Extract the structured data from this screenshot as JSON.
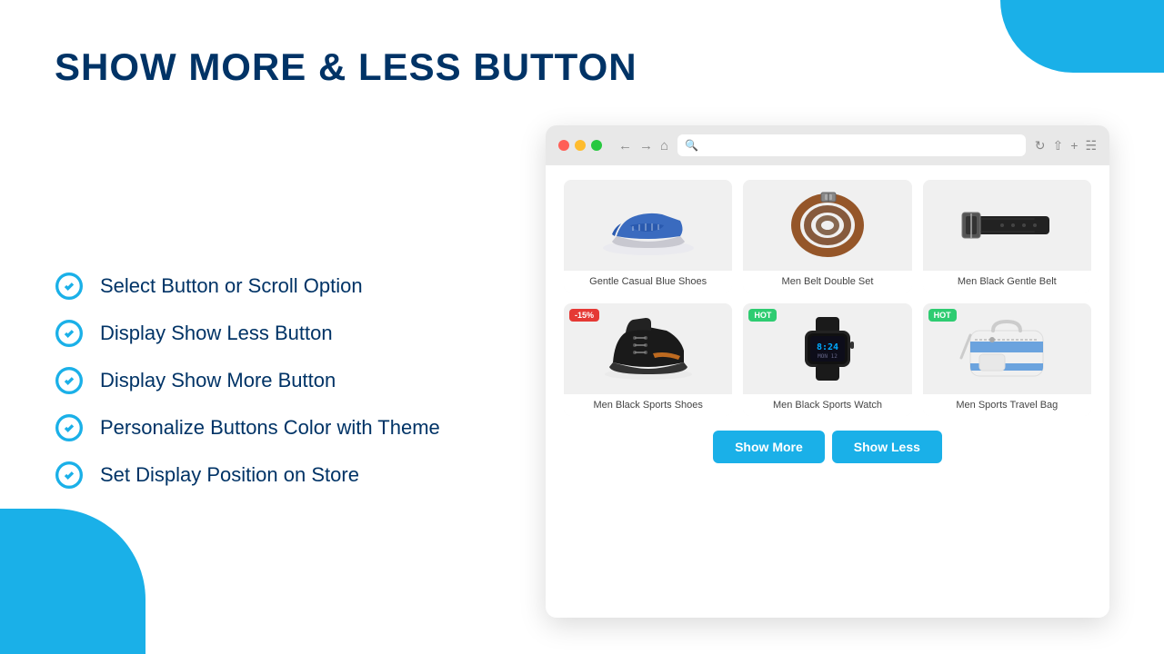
{
  "page": {
    "title": "SHOW MORE & LESS BUTTON",
    "blobs": {
      "topRight": "#1ab0e8",
      "bottomLeft": "#1ab0e8"
    }
  },
  "features": {
    "items": [
      {
        "id": "select",
        "text": "Select Button or Scroll Option"
      },
      {
        "id": "show-less",
        "text": "Display Show Less Button"
      },
      {
        "id": "show-more",
        "text": "Display Show More Button"
      },
      {
        "id": "color",
        "text": "Personalize Buttons Color with Theme"
      },
      {
        "id": "position",
        "text": "Set Display Position on Store"
      }
    ]
  },
  "browser": {
    "toolbar": {
      "searchPlaceholder": ""
    },
    "products": [
      {
        "id": "p1",
        "name": "Gentle Casual Blue Shoes",
        "badge": null,
        "row": 0
      },
      {
        "id": "p2",
        "name": "Men Belt Double Set",
        "badge": null,
        "row": 0
      },
      {
        "id": "p3",
        "name": "Men Black Gentle Belt",
        "badge": null,
        "row": 0
      },
      {
        "id": "p4",
        "name": "Men Black Sports Shoes",
        "badge": "-15%",
        "badgeType": "sale",
        "row": 1
      },
      {
        "id": "p5",
        "name": "Men Black Sports Watch",
        "badge": "HOT",
        "badgeType": "hot",
        "row": 1
      },
      {
        "id": "p6",
        "name": "Men Sports Travel Bag",
        "badge": "HOT",
        "badgeType": "hot",
        "row": 1
      }
    ],
    "buttons": {
      "showMore": "Show More",
      "showLess": "Show Less"
    }
  }
}
